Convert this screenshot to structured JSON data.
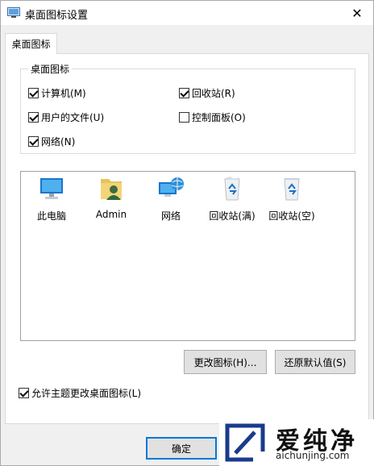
{
  "window": {
    "title": "桌面图标设置",
    "close_glyph": "✕"
  },
  "tab": {
    "label": "桌面图标"
  },
  "group": {
    "legend": "桌面图标",
    "items": [
      {
        "label": "计算机(M)",
        "checked": true
      },
      {
        "label": "回收站(R)",
        "checked": true
      },
      {
        "label": "用户的文件(U)",
        "checked": true
      },
      {
        "label": "控制面板(O)",
        "checked": false
      },
      {
        "label": "网络(N)",
        "checked": true
      }
    ]
  },
  "icons": [
    {
      "label": "此电脑",
      "icon": "computer-icon"
    },
    {
      "label": "Admin",
      "icon": "user-folder-icon"
    },
    {
      "label": "网络",
      "icon": "network-icon"
    },
    {
      "label": "回收站(满)",
      "icon": "recycle-bin-full-icon"
    },
    {
      "label": "回收站(空)",
      "icon": "recycle-bin-empty-icon"
    }
  ],
  "buttons": {
    "change_icon": "更改图标(H)...",
    "restore_default": "还原默认值(S)",
    "ok": "确定"
  },
  "theme_checkbox": {
    "label": "允许主题更改桌面图标(L)",
    "checked": true
  },
  "watermark": {
    "text": "爱纯净",
    "url": "aichunjing.com"
  },
  "colors": {
    "accent": "#0078d7",
    "watermark_logo": "#1a3a8c"
  }
}
